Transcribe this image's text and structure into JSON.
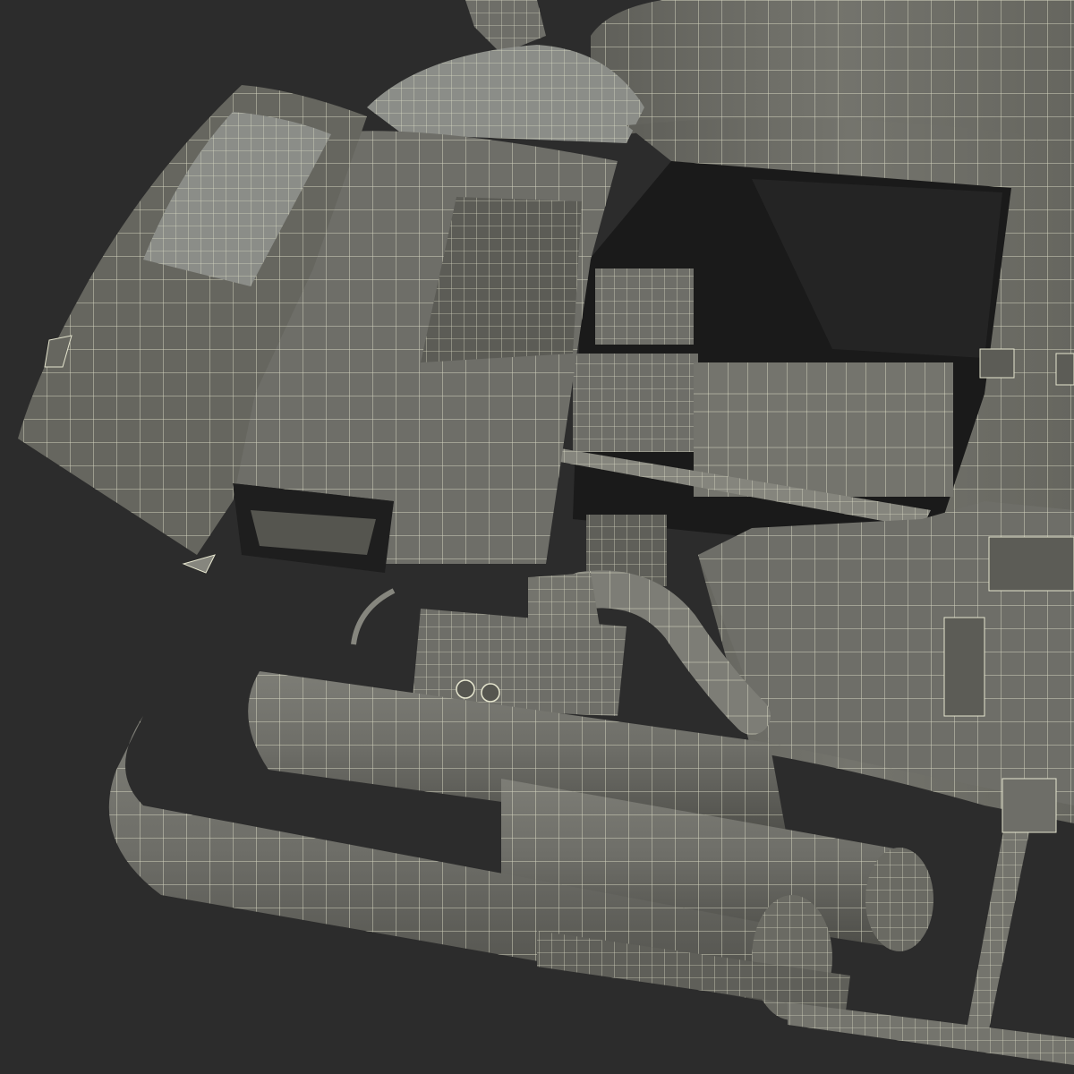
{
  "scene": {
    "subject": "helicopter-wireframe-render",
    "colors": {
      "background": "#2c2c2c",
      "body_fill": "#6e6e68",
      "body_dark": "#55554f",
      "body_light": "#86867e",
      "wire": "#e6e6cf",
      "glass": "#8b8d88",
      "interior": "#1a1a1a"
    }
  }
}
